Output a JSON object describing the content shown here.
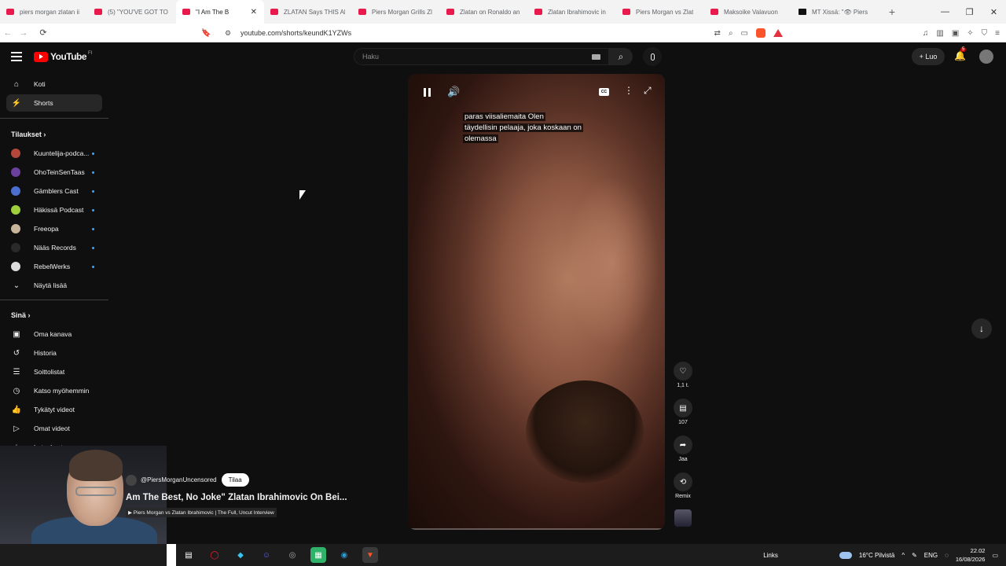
{
  "browser": {
    "tabs": [
      {
        "title": "piers morgan zlatan ii",
        "type": "yt"
      },
      {
        "title": "(5) \"YOU'VE GOT TO D",
        "type": "yt"
      },
      {
        "title": "\"I Am The B",
        "type": "yt",
        "active": true
      },
      {
        "title": "ZLATAN Says THIS Ab",
        "type": "yt"
      },
      {
        "title": "Piers Morgan Grills Zl",
        "type": "yt"
      },
      {
        "title": "Zlatan on Ronaldo an",
        "type": "yt"
      },
      {
        "title": "Zlatan Ibrahimovic in",
        "type": "yt"
      },
      {
        "title": "Piers Morgan vs Zlat",
        "type": "yt"
      },
      {
        "title": "Maksoike Valavuon",
        "type": "yt"
      },
      {
        "title": "MT Xissä: \"👁 Piers",
        "type": "x"
      }
    ],
    "new_tab": "+",
    "url": "youtube.com/shorts/keundK1YZWs",
    "nav": {
      "back": "←",
      "forward": "→",
      "refresh": "⟳"
    }
  },
  "header": {
    "logo_text": "YouTube",
    "logo_country": "FI",
    "search_placeholder": "Haku",
    "create_label": "Luo",
    "notif_count": "5"
  },
  "sidebar": {
    "main": [
      {
        "label": "Koti",
        "icon": "home-icon",
        "glyph": "⌂"
      },
      {
        "label": "Shorts",
        "icon": "shorts-icon",
        "glyph": "⚡",
        "selected": true
      }
    ],
    "subs_header": "Tilaukset",
    "subs": [
      {
        "label": "Kuuntelija-podca...",
        "color": "#b4463a"
      },
      {
        "label": "OhoTeinSenTaas",
        "color": "#6a3f9e"
      },
      {
        "label": "Gämblers Cast",
        "color": "#4b6fd1"
      },
      {
        "label": "Häkissä Podcast",
        "color": "#9fcf3a"
      },
      {
        "label": "Freeopa",
        "color": "#c8b49a"
      },
      {
        "label": "Nääs Records",
        "color": "#2a2a2a"
      },
      {
        "label": "RebelWerks",
        "color": "#ddd"
      }
    ],
    "show_more": "Näytä lisää",
    "you_header": "Sinä",
    "you": [
      {
        "label": "Oma kanava",
        "glyph": "▣"
      },
      {
        "label": "Historia",
        "glyph": "↺"
      },
      {
        "label": "Soittolistat",
        "glyph": "☰"
      },
      {
        "label": "Katso myöhemmin",
        "glyph": "◷"
      },
      {
        "label": "Tykätyt videot",
        "glyph": "👍"
      },
      {
        "label": "Omat videot",
        "glyph": "▷"
      },
      {
        "label": "Lataukset",
        "glyph": "⤓"
      }
    ]
  },
  "video": {
    "caption_line1": "paras viisaliemaita Olen",
    "caption_line2": "täydellisin pelaaja, joka koskaan on",
    "caption_line3": "olemassa",
    "progress": 0.0
  },
  "actions": [
    {
      "label": "1,1 t.",
      "glyph": "♡",
      "name": "like"
    },
    {
      "label": "107",
      "glyph": "▤",
      "name": "comment"
    },
    {
      "label": "Jaa",
      "glyph": "➦",
      "name": "share"
    },
    {
      "label": "Remix",
      "glyph": "⟲",
      "name": "remix"
    }
  ],
  "overlay": {
    "channel": "@PiersMorganUncensored",
    "subscribe": "Tilaa",
    "title": "Am The Best, No Joke\" Zlatan Ibrahimovic On Bei...",
    "link": "▶ Piers Morgan vs Zlatan Ibrahimovic | The Full, Uncut Interview"
  },
  "taskbar": {
    "links": "Links",
    "weather": "16°C  Pilvistä",
    "lang": "ENG",
    "time": "22.02",
    "date": "16/08/2026"
  }
}
